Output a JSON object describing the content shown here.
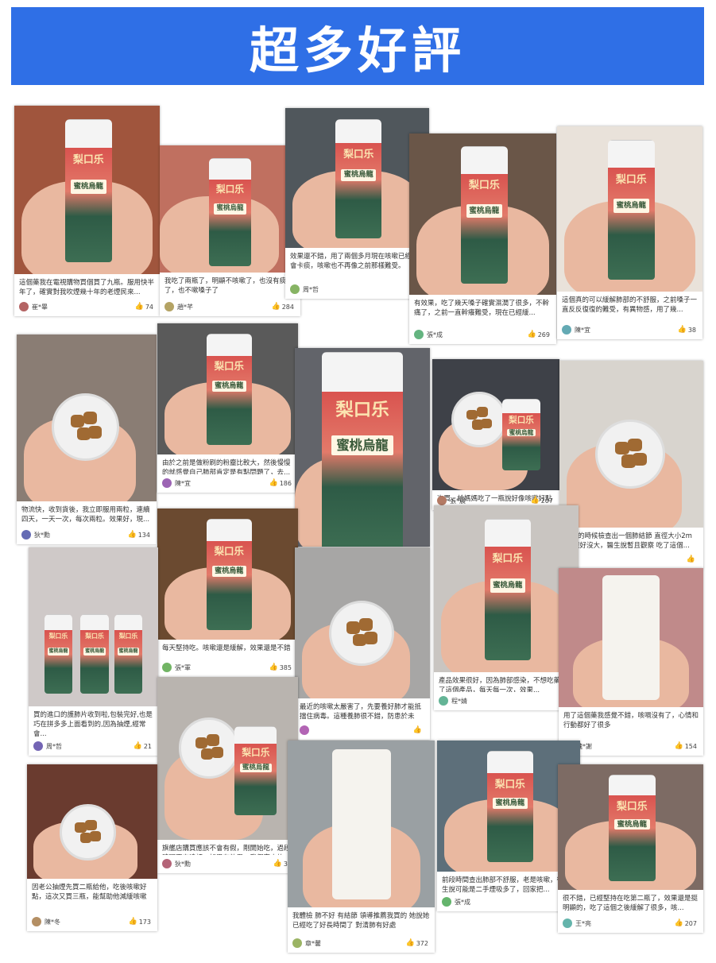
{
  "banner": {
    "title": "超多好評"
  },
  "reviews": [
    {
      "text": "這個藥我在電視購物買個買了九瓶。服用快半年了，確實對我吹煙幾十年的老煙民來...",
      "user": "崔*畢",
      "likes": "74"
    },
    {
      "text": "我吃了兩瓶了，明顯不咳嗽了，也沒有痰了，也不嗽嗓子了",
      "user": "趙*芊",
      "likes": "284"
    },
    {
      "text": "效果還不錯，用了兩個多月現在咳嗽已經不會卡痰，咳嗽也不再像之前那樣難受。",
      "user": "周*哲",
      "likes": ""
    },
    {
      "text": "有效果，吃了幾天嗓子確實濕潤了很多，不幹痛了，之前一直幹癢難受，現在已經緩...",
      "user": "張*成",
      "likes": "269"
    },
    {
      "text": "這個真的可以緩解肺部的不舒服，之前嗓子一直反反復復的難受，有異物感，用了幾...",
      "user": "陳*宜",
      "likes": "38"
    },
    {
      "text": "物流快，收到貨後，我立即服用兩粒，連續四天，一天一次，每次兩粒。效果好，現...",
      "user": "狄*勳",
      "likes": "134"
    },
    {
      "text": "由於之前是做粉刷的粉塵比較大，然後慢慢的就感覺自己肺部肯定是有點問題了，去...",
      "user": "陳*宜",
      "likes": "186"
    },
    {
      "text": "體檢的時候檢查出一個肺結節 直徑大小2mm 還好沒大，醫生說暫且觀察 吃了這個...",
      "user": "",
      "likes": ""
    },
    {
      "text": "次買，給媽媽吃了一瓶說好像咳嗽好點又接著買了兩瓶!",
      "user": "張*晨",
      "likes": "207"
    },
    {
      "text": "每天堅持吃。咳嗽還是緩解，效果還是不錯",
      "user": "張*軍",
      "likes": "385"
    },
    {
      "text": "產品效果很好，因為肺部感染，不想吃藥，買了這個產品，每天每一次，效果...",
      "user": "程*婧",
      "likes": ""
    },
    {
      "text": "用了這個藥我感覺不錯，咳嗝沒有了，心情和行動都好了很多",
      "user": "魏*謝",
      "likes": "154"
    },
    {
      "text": "買的進口的護肺片收到啦,包裝完好,也是巧在拼多多上面看到的,因為抽煙,經常會...",
      "user": "周*哲",
      "likes": "21"
    },
    {
      "text": "最近的咳嗽太嚴害了，先要養好肺才能抵擋住病毒。這種養肺很不錯，防患於未然。",
      "user": "",
      "likes": ""
    },
    {
      "text": "旗艦店購買應該不會有假，剛開始吃，過段時間再來追評，如果有效果，我們家人的...",
      "user": "狄*勳",
      "likes": "38"
    },
    {
      "text": "因老公抽煙先買二瓶給他，吃後咳嗽好點，這次又買三瓶，能幫助他減緩咳嗽",
      "user": "陳*冬",
      "likes": "173"
    },
    {
      "text": "我體檢 肺不好 有結節 領導推薦我買的 她說她已經吃了好長時間了 對清肺有好處",
      "user": "章*馨",
      "likes": "372"
    },
    {
      "text": "前段時間查出肺部不舒服，老是咳嗽，後醫生說可能是二手煙吸多了，回家把...",
      "user": "張*成",
      "likes": ""
    },
    {
      "text": "很不錯，已經堅持在吃第二瓶了，效果還是挺明顯的，吃了這個之後緩解了很多，咳...",
      "user": "王*亮",
      "likes": "207"
    }
  ],
  "product": {
    "logo": "梨口乐",
    "name": "蜜桃烏龍"
  },
  "colors": {
    "banner": "#2f6fe6",
    "bottle_red": "#d9534f",
    "bottle_green": "#2e5b46"
  }
}
